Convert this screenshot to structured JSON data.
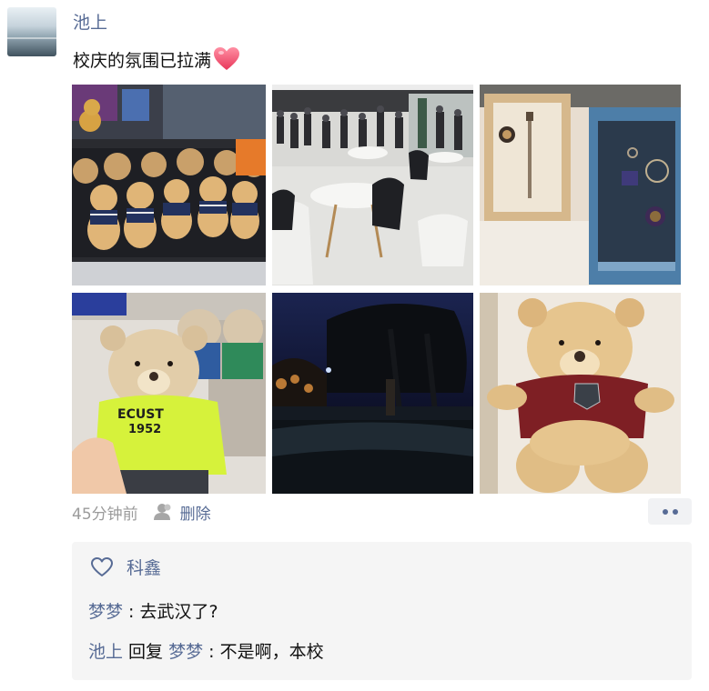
{
  "post": {
    "username": "池上",
    "text": "校庆的氛围已拉满",
    "emoji": "heart-emoji",
    "time": "45分钟前",
    "privacy_icon": "person-icon",
    "delete_label": "删除",
    "more_icon": "two-dots-icon"
  },
  "photos": [
    {
      "name": "photo-teddy-bears-display"
    },
    {
      "name": "photo-crowded-hall-with-tables"
    },
    {
      "name": "photo-keychain-gift-box"
    },
    {
      "name": "photo-bear-in-ecust-hoodie",
      "hoodie_text_1": "ECUST",
      "hoodie_text_2": "1952"
    },
    {
      "name": "photo-campus-at-night"
    },
    {
      "name": "photo-bear-in-red-sweater"
    }
  ],
  "interactions": {
    "like_icon": "heart-outline-icon",
    "likers": "科鑫",
    "comments": [
      {
        "author": "梦梦",
        "separator": " : ",
        "text": "去武汉了?"
      },
      {
        "author": "池上",
        "reply_word": " 回复 ",
        "reply_to": "梦梦",
        "separator": " : ",
        "text": "不是啊，本校"
      }
    ]
  },
  "colors": {
    "link": "#576b95",
    "text": "#111111",
    "meta": "#9b9b9b",
    "comment_bg": "#f5f5f5"
  }
}
